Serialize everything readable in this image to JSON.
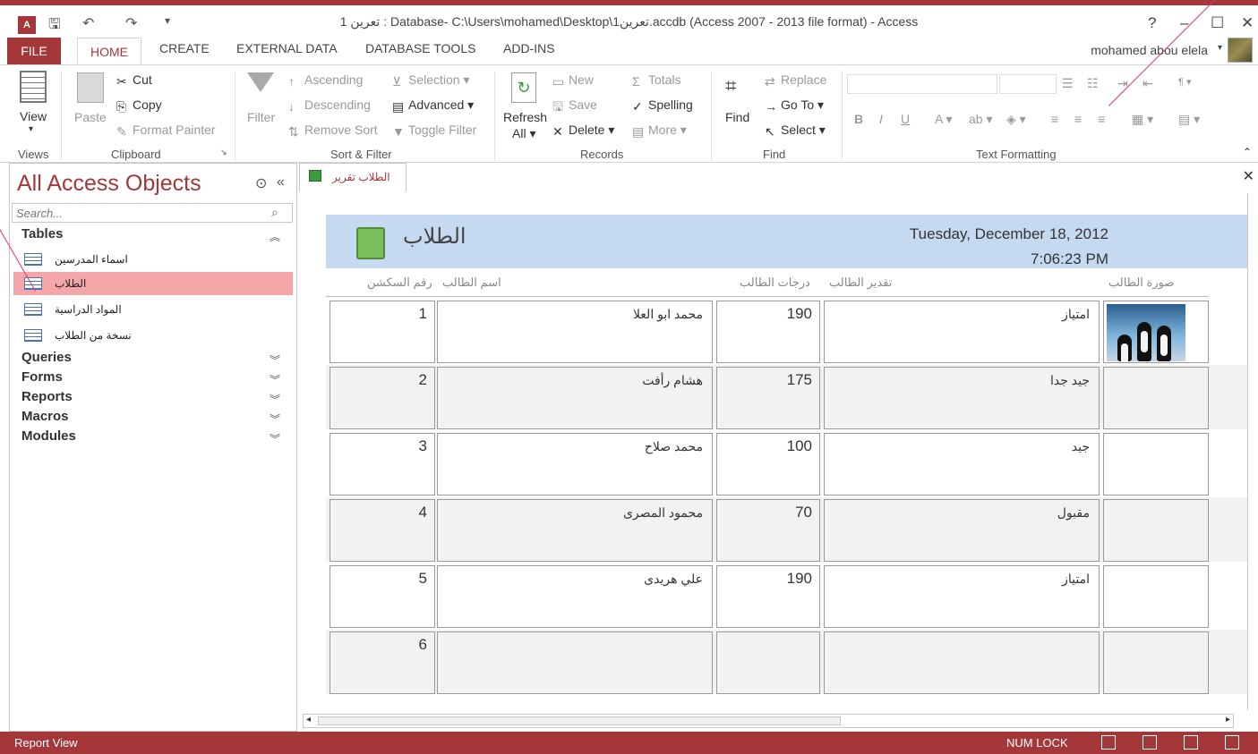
{
  "window": {
    "title": "تعرين 1 : Database- C:\\Users\\mohamed\\Desktop\\تعرين1.accdb (Access 2007 - 2013 file format) - Access",
    "help": "?",
    "minimize": "–",
    "maximize": "☐",
    "close": "✕"
  },
  "tabs": [
    "FILE",
    "HOME",
    "CREATE",
    "EXTERNAL DATA",
    "DATABASE TOOLS",
    "ADD-INS"
  ],
  "user": {
    "name": "mohamed abou elela"
  },
  "ribbon": {
    "views": {
      "view": "View",
      "group": "Views"
    },
    "clipboard": {
      "paste": "Paste",
      "cut": "Cut",
      "copy": "Copy",
      "format_painter": "Format Painter",
      "group": "Clipboard"
    },
    "sort_filter": {
      "filter": "Filter",
      "ascending": "Ascending",
      "descending": "Descending",
      "remove_sort": "Remove Sort",
      "selection": "Selection",
      "advanced": "Advanced",
      "toggle_filter": "Toggle Filter",
      "group": "Sort & Filter"
    },
    "records": {
      "refresh": "Refresh",
      "refresh_all": "All",
      "new": "New",
      "save": "Save",
      "delete": "Delete",
      "totals": "Totals",
      "spelling": "Spelling",
      "more": "More",
      "group": "Records"
    },
    "find": {
      "find": "Find",
      "replace": "Replace",
      "goto": "Go To",
      "select": "Select",
      "group": "Find"
    },
    "text_formatting": {
      "group": "Text Formatting"
    }
  },
  "nav": {
    "title": "All Access Objects",
    "search_placeholder": "Search...",
    "tables_header": "Tables",
    "tables": [
      "اسماء المدرسين",
      "الطلاب",
      "المواد الدراسية",
      "نسخة من الطلاب"
    ],
    "selected_table": "الطلاب",
    "categories": [
      "Queries",
      "Forms",
      "Reports",
      "Macros",
      "Modules"
    ]
  },
  "document": {
    "tab_label": "الطلاب تقرير"
  },
  "report": {
    "title": "الطلاب",
    "date": "Tuesday, December 18, 2012",
    "time": "7:06:23 PM",
    "columns": {
      "seat_number": "رقم السكشن",
      "student_name": "اسم الطالب",
      "grades": "درجات الطالب",
      "rating": "تقدير الطالب",
      "photo": "صورة الطالب"
    },
    "rows": [
      {
        "id": "1",
        "name": "محمد ابو العلا",
        "grade": "190",
        "rating": "امتياز",
        "has_photo": true
      },
      {
        "id": "2",
        "name": "هشام رأفت",
        "grade": "175",
        "rating": "جيد جدا",
        "has_photo": false
      },
      {
        "id": "3",
        "name": "محمد صلاح",
        "grade": "100",
        "rating": "جيد",
        "has_photo": false
      },
      {
        "id": "4",
        "name": "محمود المصرى",
        "grade": "70",
        "rating": "مقبول",
        "has_photo": false
      },
      {
        "id": "5",
        "name": "علي هريدى",
        "grade": "190",
        "rating": "امتياز",
        "has_photo": false
      },
      {
        "id": "6",
        "name": "",
        "grade": "",
        "rating": "",
        "has_photo": false
      }
    ]
  },
  "status": {
    "mode": "Report View",
    "numlock": "NUM LOCK"
  },
  "colors": {
    "accent": "#a4373a",
    "header_band": "#c5d9f1",
    "selected_item": "#f4a6a8"
  }
}
